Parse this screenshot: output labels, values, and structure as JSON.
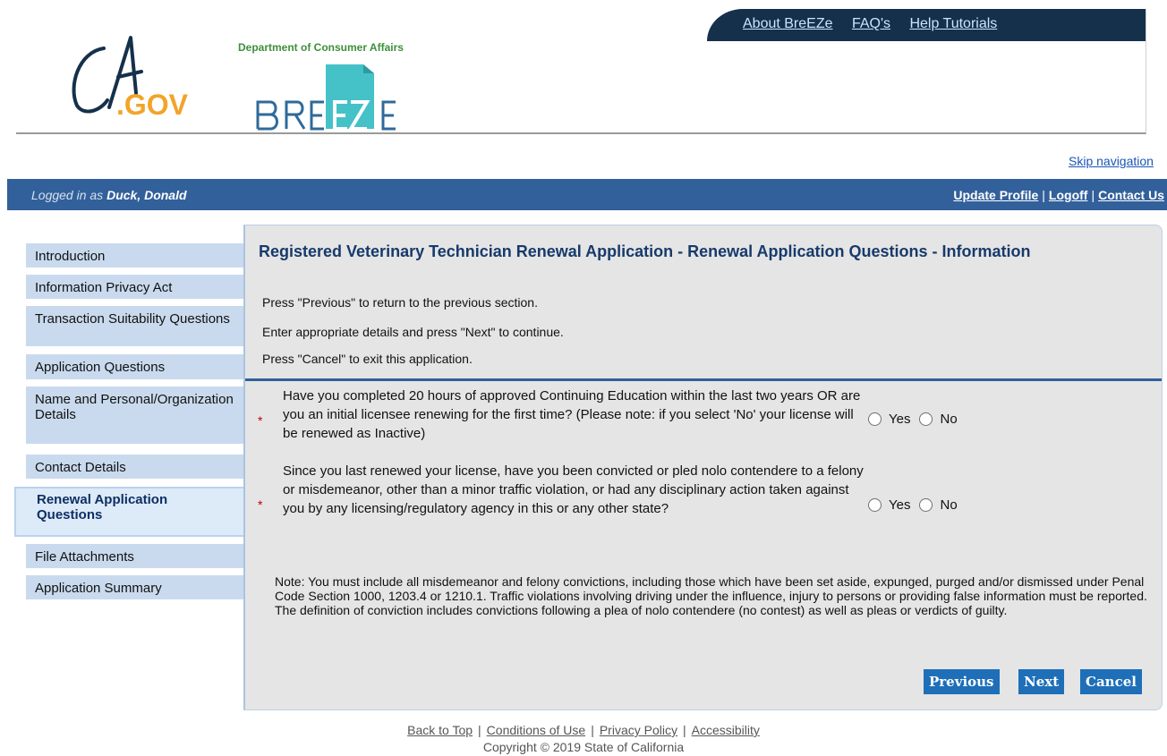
{
  "header": {
    "agency": "Department of Consumer Affairs",
    "nav_links": [
      "About BreEZe",
      "FAQ's",
      "Help Tutorials"
    ]
  },
  "skip_link": "Skip navigation",
  "userbar": {
    "logged_in_prefix": "Logged in as",
    "user_name": "Duck, Donald",
    "links": [
      "Update Profile",
      "Logoff",
      "Contact Us"
    ],
    "separator": "|"
  },
  "leftnav": {
    "items": [
      "Introduction",
      "Information Privacy Act",
      "Transaction Suitability Questions",
      "Application Questions",
      "Name and Personal/Organization Details",
      "Contact Details",
      "Renewal Application Questions",
      "File Attachments",
      "Application Summary"
    ],
    "active_index": 6
  },
  "main": {
    "title": "Registered Veterinary Technician Renewal Application - Renewal Application Questions - Information",
    "instructions": [
      "Press \"Previous\" to return to the previous section.",
      "Enter appropriate details and press \"Next\" to continue.",
      "Press \"Cancel\" to exit this application."
    ],
    "questions": [
      {
        "required_mark": "*",
        "text": "Have you completed 20 hours of approved Continuing Education within the last two years OR are you an initial licensee renewing for the first time? (Please note: if you select 'No' your license will be renewed as Inactive)",
        "yes_label": "Yes",
        "no_label": "No"
      },
      {
        "required_mark": "*",
        "text": "Since you last renewed your license, have you been convicted or pled nolo contendere to a felony or misdemeanor, other than a minor traffic violation, or had any disciplinary action taken against you by any licensing/regulatory agency in this or any other state?",
        "yes_label": "Yes",
        "no_label": "No"
      }
    ],
    "note": "Note: You must include all misdemeanor and felony convictions, including those which have been set aside, expunged, purged and/or dismissed under Penal Code Section 1000, 1203.4 or 1210.1. Traffic violations involving driving under the influence, injury to persons or providing false information must be reported. The definition of conviction includes convictions following a plea of nolo contendere (no contest) as well as pleas or verdicts of guilty.",
    "buttons": {
      "previous": "Previous",
      "next": "Next",
      "cancel": "Cancel"
    }
  },
  "footer": {
    "links": [
      "Back to Top",
      "Conditions of Use",
      "Privacy Policy",
      "Accessibility"
    ],
    "copyright": "Copyright © 2019 State of California"
  },
  "colors": {
    "topnav_bg": "#15304a",
    "userbar_bg": "#32609a",
    "nav_item_bg": "#c9daee",
    "panel_bg": "#e5e5e5",
    "button_bg": "#1e6fb8",
    "title_color": "#173a6b"
  }
}
